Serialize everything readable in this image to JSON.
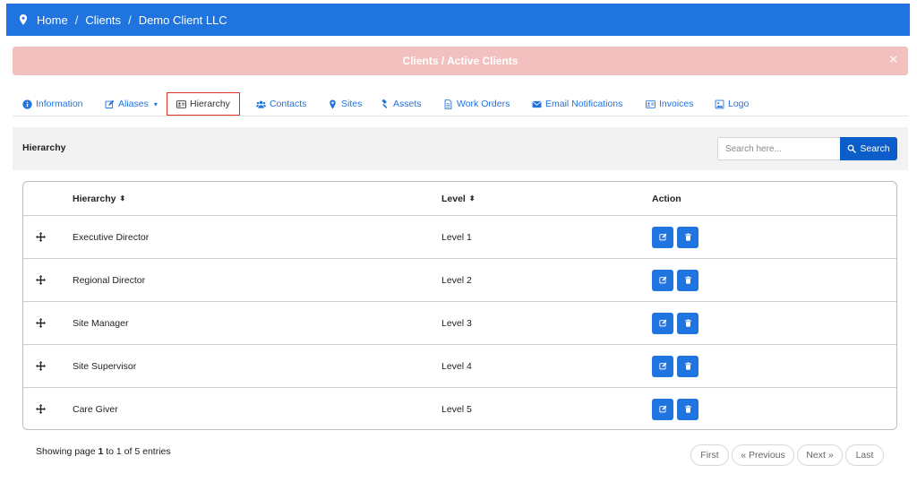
{
  "breadcrumb": {
    "icon": "map-pin-icon",
    "items": [
      "Home",
      "Clients",
      "Demo Client LLC"
    ],
    "separator": "/"
  },
  "alert": {
    "text": "Clients / Active Clients",
    "close": "×"
  },
  "tabs": [
    {
      "label": "Information",
      "icon": "info-circle-icon"
    },
    {
      "label": "Aliases",
      "icon": "edit-icon",
      "caret": "▾"
    },
    {
      "label": "Hierarchy",
      "icon": "id-card-icon",
      "active": true
    },
    {
      "label": "Contacts",
      "icon": "users-icon"
    },
    {
      "label": "Sites",
      "icon": "map-pin-icon"
    },
    {
      "label": "Assets",
      "icon": "gavel-icon"
    },
    {
      "label": "Work Orders",
      "icon": "file-text-icon"
    },
    {
      "label": "Email Notifications",
      "icon": "envelope-icon"
    },
    {
      "label": "Invoices",
      "icon": "invoice-icon"
    },
    {
      "label": "Logo",
      "icon": "image-icon"
    }
  ],
  "panel": {
    "title": "Hierarchy",
    "search_placeholder": "Search here...",
    "search_label": "Search"
  },
  "table": {
    "headers": {
      "hierarchy": "Hierarchy",
      "level": "Level",
      "action": "Action"
    },
    "sort_icon": "⬍",
    "rows": [
      {
        "hierarchy": "Executive Director",
        "level": "Level 1"
      },
      {
        "hierarchy": "Regional Director",
        "level": "Level 2"
      },
      {
        "hierarchy": "Site Manager",
        "level": "Level 3"
      },
      {
        "hierarchy": "Site Supervisor",
        "level": "Level 4"
      },
      {
        "hierarchy": "Care Giver",
        "level": "Level 5"
      }
    ]
  },
  "footer": {
    "prefix": "Showing page ",
    "page": "1",
    "middle": " to 1 of 5 entries"
  },
  "pagination": [
    "First",
    "« Previous",
    "Next »",
    "Last"
  ],
  "colors": {
    "primary": "#1f74e0",
    "alert_bg": "#f3c0c0",
    "search_button": "#0b5ec9",
    "active_tab_border": "#d9352b"
  }
}
